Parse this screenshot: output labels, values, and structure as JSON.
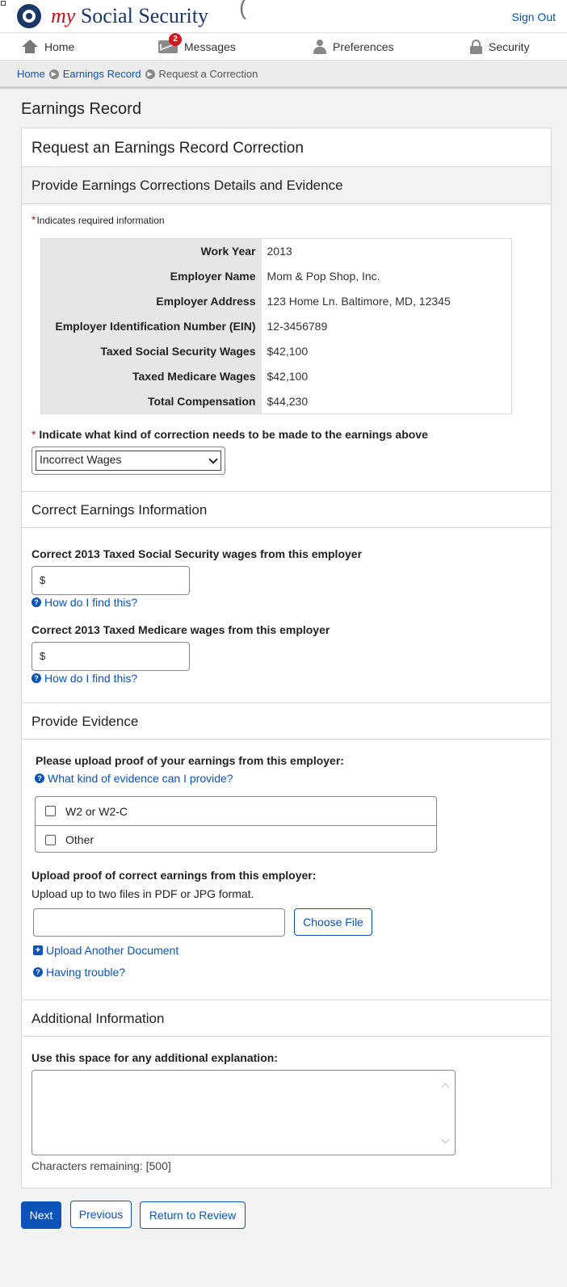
{
  "header": {
    "brand_my": "my",
    "brand_rest": "Social Security",
    "brand_cut_text": "(",
    "sign_out": "Sign Out"
  },
  "nav": {
    "home": "Home",
    "messages": "Messages",
    "messages_badge": "2",
    "preferences": "Preferences",
    "security": "Security"
  },
  "breadcrumb": {
    "home": "Home",
    "earnings_record": "Earnings Record",
    "current": "Request a Correction"
  },
  "page_title": "Earnings Record",
  "card": {
    "title": "Request an Earnings Record Correction",
    "subtitle": "Provide Earnings Corrections Details and Evidence",
    "required_star": "*",
    "required_note": "Indicates required information"
  },
  "info_table": [
    {
      "label": "Work Year",
      "value": "2013"
    },
    {
      "label": "Employer Name",
      "value": "Mom & Pop Shop, Inc."
    },
    {
      "label": "Employer Address",
      "value": "123 Home Ln. Baltimore, MD, 12345"
    },
    {
      "label": "Employer Identification Number (EIN)",
      "value": "12-3456789"
    },
    {
      "label": "Taxed Social Security Wages",
      "value": "$42,100"
    },
    {
      "label": "Taxed Medicare Wages",
      "value": "$42,100"
    },
    {
      "label": "Total Compensation",
      "value": "$44,230"
    }
  ],
  "correction": {
    "star": "*",
    "label": "Indicate what kind of correction needs to be made to the earnings above",
    "selected": "Incorrect Wages"
  },
  "correct_earnings": {
    "heading": "Correct Earnings Information",
    "ss_label": "Correct 2013 Taxed Social Security wages from this employer",
    "ss_prefix": "$",
    "medicare_label": "Correct 2013 Taxed Medicare wages from this employer",
    "medicare_prefix": "$",
    "help_link": "How do I find this?"
  },
  "evidence": {
    "heading": "Provide Evidence",
    "prompt": "Please upload proof of your earnings from this employer:",
    "help_link": "What kind of evidence can I provide?",
    "options": [
      "W2 or W2-C",
      "Other"
    ],
    "upload_label": "Upload proof of correct earnings from this employer:",
    "upload_hint": "Upload up to two files in PDF or JPG format.",
    "choose_file": "Choose File",
    "upload_another": "Upload Another Document",
    "trouble": "Having trouble?"
  },
  "additional": {
    "heading": "Additional Information",
    "label": "Use this space for any additional explanation:",
    "chars_remaining": "Characters remaining: [500]"
  },
  "buttons": {
    "next": "Next",
    "previous": "Previous",
    "return_to_review": "Return to Review"
  },
  "colors": {
    "brand_navy": "#1b3766",
    "brand_red": "#c0151f",
    "link_blue": "#0b53b8"
  }
}
